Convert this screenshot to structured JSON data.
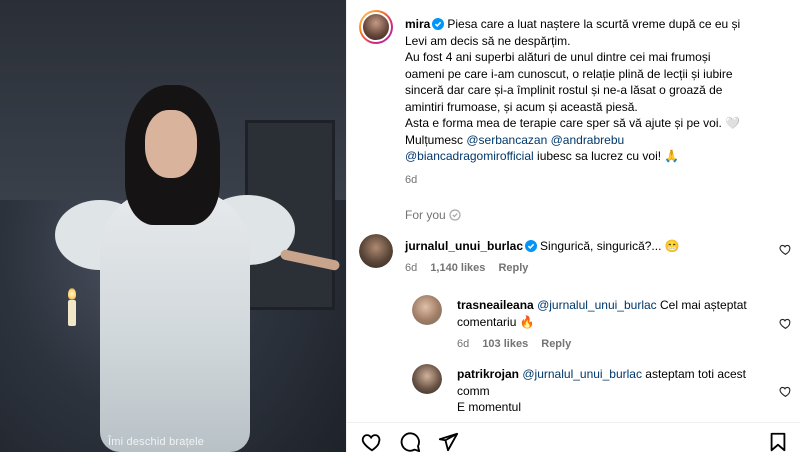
{
  "media": {
    "caption": "Îmi deschid brațele"
  },
  "post": {
    "username": "mira",
    "caption_lines": [
      "Piesa care a luat naștere la scurtă vreme după ce eu și",
      "Levi am decis să ne despărțim.",
      "Au fost 4 ani superbi alături de unul dintre cei mai frumoși",
      "oameni pe care i-am cunoscut, o relație plină de lecții și iubire",
      "sinceră dar care și-a împlinit rostul și ne-a lăsat o groază de",
      "amintiri frumoase, și acum și această piesă.",
      "Asta e forma mea de terapie care sper să vă ajute și pe voi. 🤍"
    ],
    "thanks_prefix": "Mulțumesc",
    "mention_1": "@serbancazan",
    "mention_2": "@andrabrebu",
    "mention_3": "@biancadragomirofficial",
    "thanks_suffix": "iubesc sa lucrez cu voi! 🙏",
    "time": "6d"
  },
  "section_label": "For you",
  "comments": [
    {
      "username": "jurnalul_unui_burlac",
      "text": "Singurică, singurică?... 😁",
      "time": "6d",
      "likes": "1,140 likes",
      "reply": "Reply"
    },
    {
      "username": "trasneaileana",
      "mention": "@jurnalul_unui_burlac",
      "text": "Cel mai așteptat",
      "text2": "comentariu 🔥",
      "time": "6d",
      "likes": "103 likes",
      "reply": "Reply"
    },
    {
      "username": "patrikrojan",
      "mention": "@jurnalul_unui_burlac",
      "text": "asteptam toti acest",
      "text2": "comm",
      "text3": "E momentul"
    }
  ],
  "icons": {
    "verified": "verified-badge-icon",
    "like": "heart-icon",
    "comment": "comment-bubble-icon",
    "share": "paper-plane-icon",
    "save": "bookmark-icon",
    "foryou_info": "info-circle-icon"
  },
  "colors": {
    "verified_blue": "#0095f6",
    "mention": "#00376b",
    "meta_gray": "#737373"
  }
}
